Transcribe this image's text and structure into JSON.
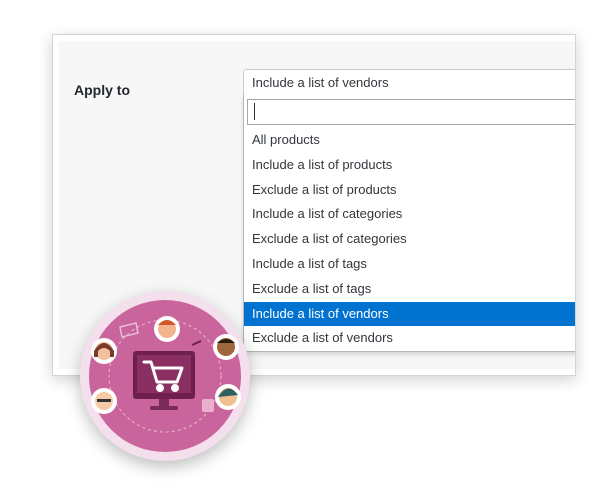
{
  "form": {
    "label": "Apply to",
    "selected_value": "Include a list of vendors",
    "search": {
      "value": "",
      "placeholder": ""
    },
    "options": [
      "All products",
      "Include a list of products",
      "Exclude a list of products",
      "Include a list of categories",
      "Exclude a list of categories",
      "Include a list of tags",
      "Exclude a list of tags",
      "Include a list of vendors",
      "Exclude a list of vendors"
    ],
    "highlighted_index": 7
  },
  "colors": {
    "highlight": "#0073d1",
    "badge_outer": "#f3e0ec",
    "badge_inner": "#c9649c"
  },
  "icons": [
    "shopping-cart-icon",
    "monitor-icon",
    "people-avatars-icon"
  ]
}
